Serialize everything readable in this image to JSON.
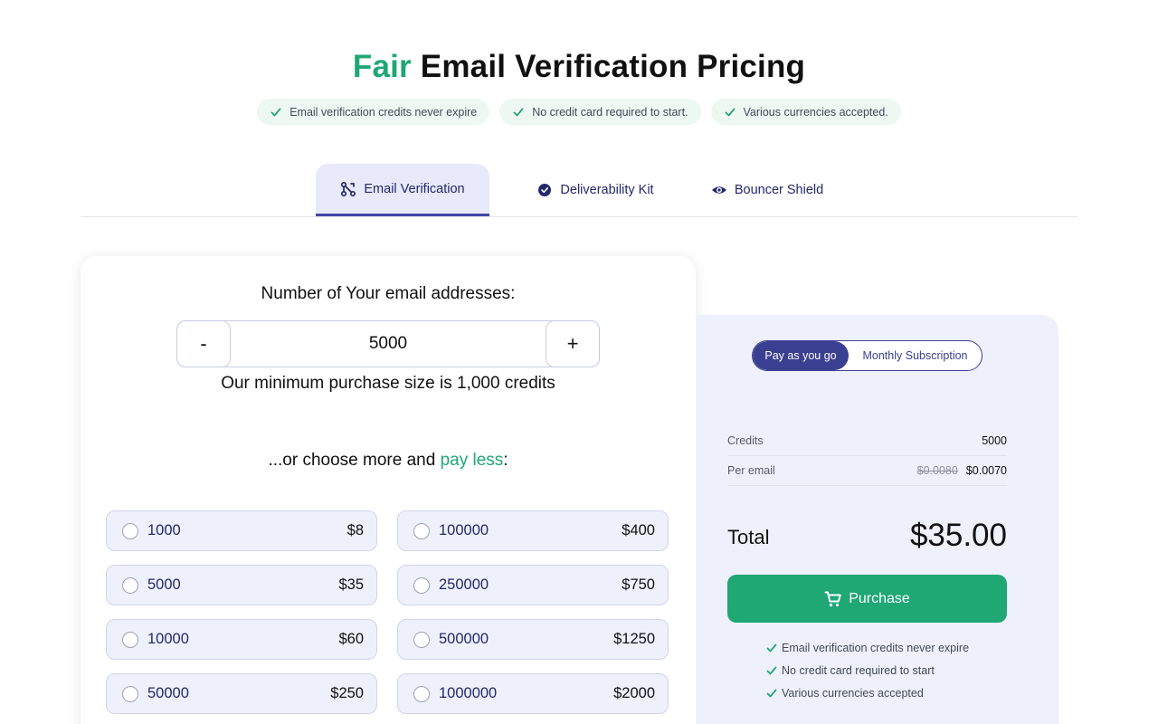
{
  "header": {
    "title_accent": "Fair",
    "title_rest": " Email Verification Pricing",
    "features": [
      "Email verification credits never expire",
      "No credit card required to start.",
      "Various currencies accepted."
    ]
  },
  "tabs": [
    {
      "label": "Email Verification",
      "icon": "branch-icon",
      "active": true
    },
    {
      "label": "Deliverability Kit",
      "icon": "badge-icon",
      "active": false
    },
    {
      "label": "Bouncer Shield",
      "icon": "eye-icon",
      "active": false
    }
  ],
  "calculator": {
    "label": "Number of Your email addresses:",
    "minus": "-",
    "plus": "+",
    "value": "5000",
    "min_note": "Our minimum purchase size is 1,000 credits",
    "choose_prefix": "...or choose more and ",
    "choose_accent": "pay less",
    "choose_suffix": ":",
    "options": [
      {
        "qty": "1000",
        "price": "$8"
      },
      {
        "qty": "100000",
        "price": "$400"
      },
      {
        "qty": "5000",
        "price": "$35"
      },
      {
        "qty": "250000",
        "price": "$750"
      },
      {
        "qty": "10000",
        "price": "$60"
      },
      {
        "qty": "500000",
        "price": "$1250"
      },
      {
        "qty": "50000",
        "price": "$250"
      },
      {
        "qty": "1000000",
        "price": "$2000"
      }
    ]
  },
  "summary": {
    "toggle": {
      "active": "Pay as you go",
      "inactive": "Monthly Subscription"
    },
    "credits_label": "Credits",
    "credits_value": "5000",
    "per_email_label": "Per email",
    "per_email_old": "$0.0080",
    "per_email_new": "$0.0070",
    "total_label": "Total",
    "total_value": "$35.00",
    "purchase_label": "Purchase",
    "perks": [
      "Email verification credits never expire",
      "No credit card required to start",
      "Various currencies accepted"
    ]
  },
  "colors": {
    "accent_green": "#1fa774",
    "brand_navy": "#3b3f91",
    "panel_bg": "#eef0fb"
  }
}
